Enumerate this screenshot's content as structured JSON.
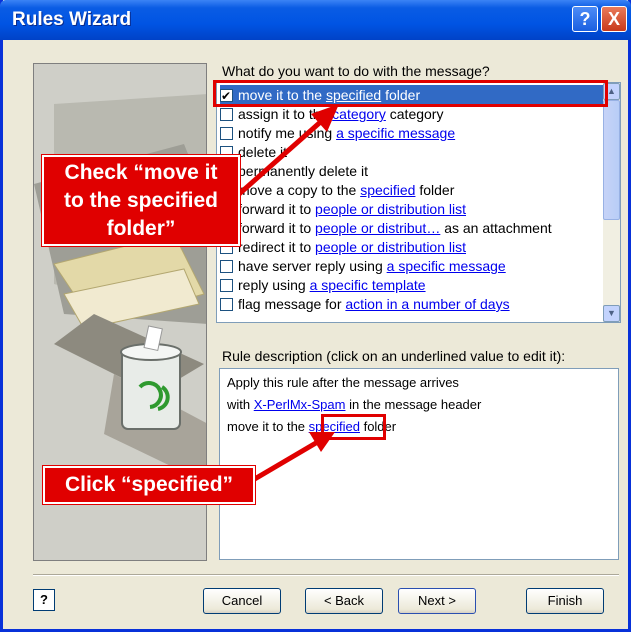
{
  "window": {
    "title": "Rules Wizard",
    "help_glyph": "?",
    "close_glyph": "X"
  },
  "question_label": "What do you want to do with the message?",
  "actions": [
    {
      "text": "move it to the ",
      "link": "specified",
      "suffix": " folder",
      "checked": true,
      "selected": true
    },
    {
      "text": "assign it to the ",
      "link": "category",
      "suffix": " category",
      "checked": false
    },
    {
      "text": "notify me using ",
      "link": "a specific message",
      "suffix": "",
      "checked": false
    },
    {
      "text": "delete it",
      "link": "",
      "suffix": "",
      "checked": false
    },
    {
      "text": "permanently delete it",
      "link": "",
      "suffix": "",
      "checked": false
    },
    {
      "text": "move a copy to the ",
      "link": "specified",
      "suffix": " folder",
      "checked": false
    },
    {
      "text": "forward it to ",
      "link": "people or distribution list",
      "suffix": "",
      "checked": false
    },
    {
      "text": "forward it to ",
      "link": "people or distribut…",
      "suffix": " as an attachment",
      "checked": false
    },
    {
      "text": "redirect it to ",
      "link": "people or distribution list",
      "suffix": "",
      "checked": false
    },
    {
      "text": "have server reply using ",
      "link": "a specific message",
      "suffix": "",
      "checked": false
    },
    {
      "text": "reply using ",
      "link": "a specific template",
      "suffix": "",
      "checked": false
    },
    {
      "text": "flag message for ",
      "link": "action in a number of days",
      "suffix": "",
      "checked": false
    }
  ],
  "description": {
    "label": "Rule description (click on an underlined value to edit it):",
    "line1": "Apply this rule after the message arrives",
    "line2_pre": "with ",
    "line2_link": "X-PerlMx-Spam",
    "line2_post": " in the message header",
    "line3_pre": "move it to the ",
    "line3_link": "specified",
    "line3_post": " folder"
  },
  "buttons": {
    "help": "?",
    "cancel": "Cancel",
    "back": "< Back",
    "next": "Next >",
    "finish": "Finish"
  },
  "annotations": {
    "callout1_l1": "Check “move it",
    "callout1_l2": "to the specified",
    "callout1_l3": "folder”",
    "callout2": "Click “specified”"
  },
  "colors": {
    "accent": "#e00000",
    "titlebar": "#0054e3",
    "dialog_bg": "#ece9d8",
    "link": "#0000ee",
    "selection": "#316ac5"
  }
}
